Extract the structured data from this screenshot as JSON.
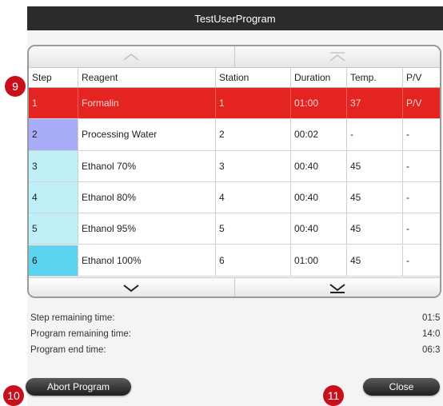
{
  "window": {
    "title": "TestUserProgram"
  },
  "table": {
    "headers": [
      "Step",
      "Reagent",
      "Station",
      "Duration",
      "Temp.",
      "P/V"
    ],
    "rows": [
      {
        "cells": [
          "1",
          "Formalin",
          "1",
          "01:00",
          "37",
          "P/V"
        ],
        "step_color": "#e32421",
        "selected": true
      },
      {
        "cells": [
          "2",
          "Processing Water",
          "2",
          "00:02",
          "-",
          "-"
        ],
        "step_color": "#a9acf7",
        "selected": false
      },
      {
        "cells": [
          "3",
          "Ethanol 70%",
          "3",
          "00:40",
          "45",
          "-"
        ],
        "step_color": "#bff0f7",
        "selected": false
      },
      {
        "cells": [
          "4",
          "Ethanol 80%",
          "4",
          "00:40",
          "45",
          "-"
        ],
        "step_color": "#bff0f7",
        "selected": false
      },
      {
        "cells": [
          "5",
          "Ethanol 95%",
          "5",
          "00:40",
          "45",
          "-"
        ],
        "step_color": "#bff0f7",
        "selected": false
      },
      {
        "cells": [
          "6",
          "Ethanol 100%",
          "6",
          "01:00",
          "45",
          "-"
        ],
        "step_color": "#5cd4ef",
        "selected": false
      }
    ],
    "scroll_icons": [
      "chevron-up-icon",
      "scroll-to-top-icon",
      "chevron-down-icon",
      "scroll-to-bottom-icon"
    ]
  },
  "info": {
    "step_remaining_label": "Step remaining time:",
    "step_remaining_value": "01:5",
    "program_remaining_label": "Program remaining time:",
    "program_remaining_value": "14:0",
    "program_end_label": "Program end time:",
    "program_end_value": "06:3"
  },
  "buttons": {
    "abort": "Abort Program",
    "close": "Close"
  },
  "callouts": {
    "c9": "9",
    "c10": "10",
    "c11": "11"
  },
  "colors": {
    "callout": "#c8101b",
    "selected_row": "#e32421",
    "titlebar": "#2b2b2b"
  }
}
